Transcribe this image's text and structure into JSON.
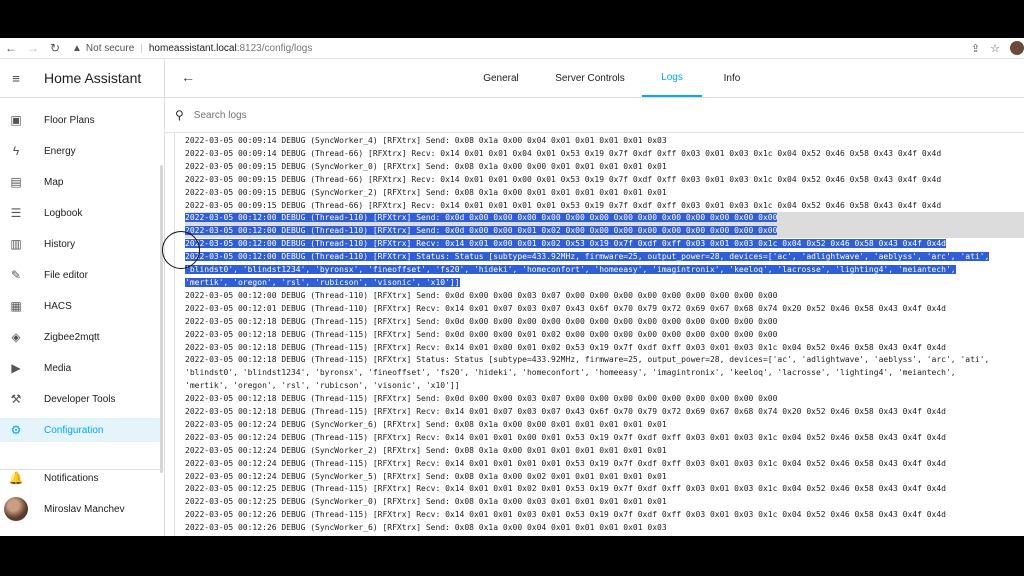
{
  "browser": {
    "back": "←",
    "forward": "→",
    "reload": "↻",
    "warning_icon": "▲",
    "not_secure": "Not secure",
    "host": "homeassistant.local",
    "path": ":8123/config/logs",
    "share_icon": "⇪",
    "star_icon": "☆"
  },
  "sidebar": {
    "title": "Home Assistant",
    "menu_icon": "≡",
    "items": [
      {
        "label": "Floor Plans",
        "icon": "▣"
      },
      {
        "label": "Energy",
        "icon": "ϟ"
      },
      {
        "label": "Map",
        "icon": "▤"
      },
      {
        "label": "Logbook",
        "icon": "☰"
      },
      {
        "label": "History",
        "icon": "▥"
      },
      {
        "label": "File editor",
        "icon": "✎"
      },
      {
        "label": "HACS",
        "icon": "▦"
      },
      {
        "label": "Zigbee2mqtt",
        "icon": "◈"
      },
      {
        "label": "Media",
        "icon": "▶"
      },
      {
        "label": "Developer Tools",
        "icon": "⚒"
      },
      {
        "label": "Configuration",
        "icon": "⚙"
      }
    ],
    "notifications": {
      "label": "Notifications",
      "icon": "🔔"
    },
    "user": {
      "label": "Miroslav Manchev"
    }
  },
  "main": {
    "back_icon": "←",
    "tabs": [
      {
        "label": "General"
      },
      {
        "label": "Server Controls"
      },
      {
        "label": "Logs"
      },
      {
        "label": "Info"
      }
    ],
    "active_tab": "Logs",
    "search_icon": "⚲",
    "search_placeholder": "Search logs"
  },
  "logs": [
    "2022-03-05 00:09:14 DEBUG (SyncWorker_4) [RFXtrx] Send: 0x08 0x1a 0x00 0x04 0x01 0x01 0x01 0x01 0x03",
    "2022-03-05 00:09:14 DEBUG (Thread-66) [RFXtrx] Recv: 0x14 0x01 0x01 0x04 0x01 0x53 0x19 0x7f 0xdf 0xff 0x03 0x01 0x03 0x1c 0x04 0x52 0x46 0x58 0x43 0x4f 0x4d",
    "2022-03-05 00:09:15 DEBUG (SyncWorker_0) [RFXtrx] Send: 0x08 0x1a 0x00 0x00 0x01 0x01 0x01 0x01 0x01",
    "2022-03-05 00:09:15 DEBUG (Thread-66) [RFXtrx] Recv: 0x14 0x01 0x01 0x00 0x01 0x53 0x19 0x7f 0xdf 0xff 0x03 0x01 0x03 0x1c 0x04 0x52 0x46 0x58 0x43 0x4f 0x4d",
    "2022-03-05 00:09:15 DEBUG (SyncWorker_2) [RFXtrx] Send: 0x08 0x1a 0x00 0x01 0x01 0x01 0x01 0x01 0x01",
    "2022-03-05 00:09:15 DEBUG (Thread-66) [RFXtrx] Recv: 0x14 0x01 0x01 0x01 0x01 0x53 0x19 0x7f 0xdf 0xff 0x03 0x01 0x03 0x1c 0x04 0x52 0x46 0x58 0x43 0x4f 0x4d",
    "2022-03-05 00:12:00 DEBUG (Thread-110) [RFXtrx] Send: 0x0d 0x00 0x00 0x00 0x00 0x00 0x00 0x00 0x00 0x00 0x00 0x00 0x00 0x00",
    "2022-03-05 00:12:00 DEBUG (Thread-110) [RFXtrx] Send: 0x0d 0x00 0x00 0x01 0x02 0x00 0x00 0x00 0x00 0x00 0x00 0x00 0x00 0x00",
    "2022-03-05 00:12:00 DEBUG (Thread-110) [RFXtrx] Recv: 0x14 0x01 0x00 0x01 0x02 0x53 0x19 0x7f 0xdf 0xff 0x03 0x01 0x03 0x1c 0x04 0x52 0x46 0x58 0x43 0x4f 0x4d",
    "2022-03-05 00:12:00 DEBUG (Thread-110) [RFXtrx] Status: Status [subtype=433.92MHz, firmware=25, output_power=28, devices=['ac', 'adlightwave', 'aeblyss', 'arc', 'ati',",
    "'blindst0', 'blindst1234', 'byronsx', 'fineoffset', 'fs20', 'hideki', 'homeconfort', 'homeeasy', 'imagintronix', 'keeloq', 'lacrosse', 'lighting4', 'meiantech',",
    "'mertik', 'oregon', 'rsl', 'rubicson', 'visonic', 'x10']]",
    "2022-03-05 00:12:00 DEBUG (Thread-110) [RFXtrx] Send: 0x0d 0x00 0x00 0x03 0x07 0x00 0x00 0x00 0x00 0x00 0x00 0x00 0x00 0x00",
    "2022-03-05 00:12:01 DEBUG (Thread-110) [RFXtrx] Recv: 0x14 0x01 0x07 0x03 0x07 0x43 0x6f 0x70 0x79 0x72 0x69 0x67 0x68 0x74 0x20 0x52 0x46 0x58 0x43 0x4f 0x4d",
    "2022-03-05 00:12:18 DEBUG (Thread-115) [RFXtrx] Send: 0x0d 0x00 0x00 0x00 0x00 0x00 0x00 0x00 0x00 0x00 0x00 0x00 0x00 0x00",
    "2022-03-05 00:12:18 DEBUG (Thread-115) [RFXtrx] Send: 0x0d 0x00 0x00 0x01 0x02 0x00 0x00 0x00 0x00 0x00 0x00 0x00 0x00 0x00",
    "2022-03-05 00:12:18 DEBUG (Thread-115) [RFXtrx] Recv: 0x14 0x01 0x00 0x01 0x02 0x53 0x19 0x7f 0xdf 0xff 0x03 0x01 0x03 0x1c 0x04 0x52 0x46 0x58 0x43 0x4f 0x4d",
    "2022-03-05 00:12:18 DEBUG (Thread-115) [RFXtrx] Status: Status [subtype=433.92MHz, firmware=25, output_power=28, devices=['ac', 'adlightwave', 'aeblyss', 'arc', 'ati',",
    "'blindst0', 'blindst1234', 'byronsx', 'fineoffset', 'fs20', 'hideki', 'homeconfort', 'homeeasy', 'imagintronix', 'keeloq', 'lacrosse', 'lighting4', 'meiantech',",
    "'mertik', 'oregon', 'rsl', 'rubicson', 'visonic', 'x10']]",
    "2022-03-05 00:12:18 DEBUG (Thread-115) [RFXtrx] Send: 0x0d 0x00 0x00 0x03 0x07 0x00 0x00 0x00 0x00 0x00 0x00 0x00 0x00 0x00",
    "2022-03-05 00:12:18 DEBUG (Thread-115) [RFXtrx] Recv: 0x14 0x01 0x07 0x03 0x07 0x43 0x6f 0x70 0x79 0x72 0x69 0x67 0x68 0x74 0x20 0x52 0x46 0x58 0x43 0x4f 0x4d",
    "2022-03-05 00:12:24 DEBUG (SyncWorker_6) [RFXtrx] Send: 0x08 0x1a 0x00 0x00 0x01 0x01 0x01 0x01 0x01",
    "2022-03-05 00:12:24 DEBUG (Thread-115) [RFXtrx] Recv: 0x14 0x01 0x01 0x00 0x01 0x53 0x19 0x7f 0xdf 0xff 0x03 0x01 0x03 0x1c 0x04 0x52 0x46 0x58 0x43 0x4f 0x4d",
    "2022-03-05 00:12:24 DEBUG (SyncWorker_2) [RFXtrx] Send: 0x08 0x1a 0x00 0x01 0x01 0x01 0x01 0x01 0x01",
    "2022-03-05 00:12:24 DEBUG (Thread-115) [RFXtrx] Recv: 0x14 0x01 0x01 0x01 0x01 0x53 0x19 0x7f 0xdf 0xff 0x03 0x01 0x03 0x1c 0x04 0x52 0x46 0x58 0x43 0x4f 0x4d",
    "2022-03-05 00:12:24 DEBUG (SyncWorker_5) [RFXtrx] Send: 0x08 0x1a 0x00 0x02 0x01 0x01 0x01 0x01 0x01",
    "2022-03-05 00:12:25 DEBUG (Thread-115) [RFXtrx] Recv: 0x14 0x01 0x01 0x02 0x01 0x53 0x19 0x7f 0xdf 0xff 0x03 0x01 0x03 0x1c 0x04 0x52 0x46 0x58 0x43 0x4f 0x4d",
    "2022-03-05 00:12:25 DEBUG (SyncWorker_0) [RFXtrx] Send: 0x08 0x1a 0x00 0x03 0x01 0x01 0x01 0x01 0x01",
    "2022-03-05 00:12:26 DEBUG (Thread-115) [RFXtrx] Recv: 0x14 0x01 0x01 0x03 0x01 0x53 0x19 0x7f 0xdf 0xff 0x03 0x01 0x03 0x1c 0x04 0x52 0x46 0x58 0x43 0x4f 0x4d",
    "2022-03-05 00:12:26 DEBUG (SyncWorker_6) [RFXtrx] Send: 0x08 0x1a 0x00 0x04 0x01 0x01 0x01 0x01 0x03"
  ],
  "selection": {
    "first_line": 6,
    "last_line": 11
  },
  "colors": {
    "accent": "#03a9f4",
    "selection": "#2f5ed8"
  }
}
